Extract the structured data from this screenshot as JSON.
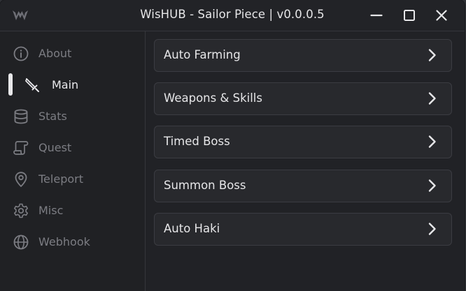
{
  "window": {
    "title": "WisHUB - Sailor Piece | v0.0.0.5",
    "controls": {
      "minimize_icon": "minimize-icon",
      "maximize_icon": "maximize-icon",
      "close_icon": "close-icon"
    }
  },
  "sidebar": {
    "items": [
      {
        "label": "About",
        "icon": "info-icon",
        "active": false
      },
      {
        "label": "Main",
        "icon": "sword-icon",
        "active": true
      },
      {
        "label": "Stats",
        "icon": "database-icon",
        "active": false
      },
      {
        "label": "Quest",
        "icon": "scroll-icon",
        "active": false
      },
      {
        "label": "Teleport",
        "icon": "map-pin-icon",
        "active": false
      },
      {
        "label": "Misc",
        "icon": "gear-icon",
        "active": false
      },
      {
        "label": "Webhook",
        "icon": "globe-icon",
        "active": false
      }
    ]
  },
  "main": {
    "sections": [
      {
        "label": "Auto Farming"
      },
      {
        "label": "Weapons & Skills"
      },
      {
        "label": "Timed Boss"
      },
      {
        "label": "Summon Boss"
      },
      {
        "label": "Auto Haki"
      }
    ]
  },
  "colors": {
    "background": "#212226",
    "card": "#28292d",
    "card_border": "#3b3c42",
    "text_primary": "#e6e6e8",
    "text_muted": "#7c7d83",
    "active_indicator": "#e8e8ea"
  }
}
